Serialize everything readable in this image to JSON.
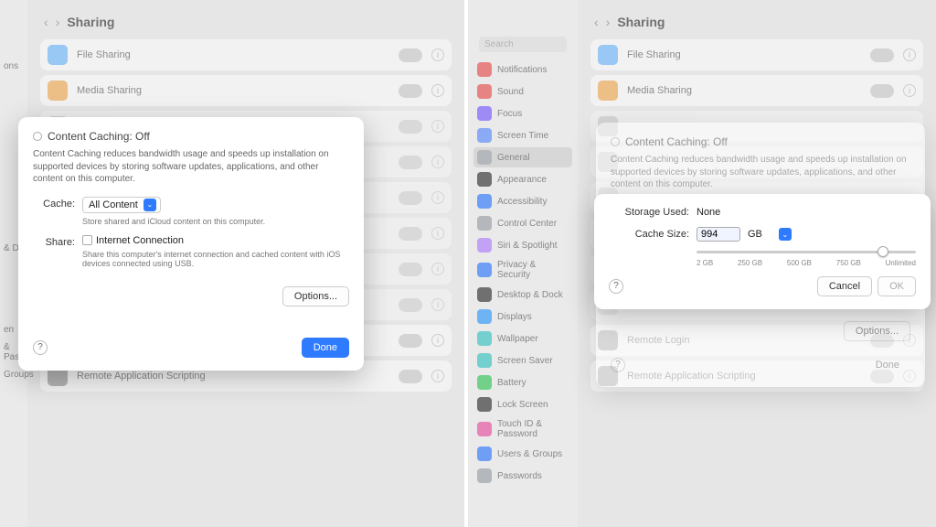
{
  "nav": {
    "back_glyph": "‹",
    "fwd_glyph": "›",
    "title": "Sharing"
  },
  "sidebar_full": {
    "search_placeholder": "Search",
    "items": [
      {
        "label": "Notifications",
        "color": "#e94f4f"
      },
      {
        "label": "Sound",
        "color": "#e94f4f"
      },
      {
        "label": "Focus",
        "color": "#7a5cff"
      },
      {
        "label": "Screen Time",
        "color": "#5b8cff"
      },
      {
        "label": "General",
        "color": "#9aa0a6",
        "sel": true
      },
      {
        "label": "Appearance",
        "color": "#333"
      },
      {
        "label": "Accessibility",
        "color": "#2f7bff"
      },
      {
        "label": "Control Center",
        "color": "#9aa0a6"
      },
      {
        "label": "Siri & Spotlight",
        "color": "#b07fff"
      },
      {
        "label": "Privacy & Security",
        "color": "#2f7bff"
      },
      {
        "label": "Desktop & Dock",
        "color": "#333"
      },
      {
        "label": "Displays",
        "color": "#2f9bff"
      },
      {
        "label": "Wallpaper",
        "color": "#39c4c4"
      },
      {
        "label": "Screen Saver",
        "color": "#39c4c4"
      },
      {
        "label": "Battery",
        "color": "#35c759"
      },
      {
        "label": "Lock Screen",
        "color": "#333"
      },
      {
        "label": "Touch ID & Password",
        "color": "#e94f9f"
      },
      {
        "label": "Users & Groups",
        "color": "#2f7bff"
      },
      {
        "label": "Passwords",
        "color": "#9aa0a6"
      }
    ]
  },
  "sidebar_narrow": {
    "items": [
      {
        "label": "ons"
      },
      {
        "label": ""
      },
      {
        "label": ""
      },
      {
        "label": ""
      },
      {
        "label": ""
      },
      {
        "label": ""
      },
      {
        "label": ""
      },
      {
        "label": "& D"
      },
      {
        "label": ""
      },
      {
        "label": ""
      },
      {
        "label": "en"
      },
      {
        "label": "& Password"
      },
      {
        "label": "Groups"
      }
    ]
  },
  "bg_services": {
    "items": [
      {
        "label": "File Sharing",
        "color": "#5ab3ff"
      },
      {
        "label": "Media Sharing",
        "color": "#f2a23c"
      },
      {
        "label_placeholder": "",
        "color": "#b0b0b0"
      },
      {
        "label_placeholder": "",
        "color": "#b0b0b0"
      },
      {
        "label_placeholder": "",
        "color": "#b0b0b0"
      },
      {
        "label_placeholder": "",
        "color": "#b0b0b0"
      },
      {
        "label_placeholder": "",
        "color": "#b0b0b0"
      },
      {
        "label_placeholder": "",
        "color": "#b0b0b0"
      },
      {
        "label": "Remote Login",
        "color": "#8a8a8a"
      },
      {
        "label": "Remote Application Scripting",
        "color": "#8a8a8a"
      }
    ]
  },
  "modal_main": {
    "title": "Content Caching: Off",
    "desc": "Content Caching reduces bandwidth usage and speeds up installation on supported devices by storing software updates, applications, and other content on this computer.",
    "cache_label": "Cache:",
    "cache_value": "All Content",
    "cache_hint": "Store shared and iCloud content on this computer.",
    "share_label": "Share:",
    "share_checkbox_label": "Internet Connection",
    "share_hint": "Share this computer's internet connection and cached content with iOS devices connected using USB.",
    "options_btn": "Options...",
    "done_btn": "Done",
    "help_glyph": "?"
  },
  "modal_opts": {
    "storage_used_label": "Storage Used:",
    "storage_used_value": "None",
    "cache_size_label": "Cache Size:",
    "cache_size_value": "994",
    "cache_size_unit": "GB",
    "slider_ticks": [
      "2 GB",
      "250 GB",
      "500 GB",
      "750 GB",
      "Unlimited"
    ],
    "cancel_btn": "Cancel",
    "ok_btn": "OK",
    "help_glyph": "?"
  },
  "done_plain": "Done",
  "info_glyph": "i",
  "caret_glyph": "⌄"
}
